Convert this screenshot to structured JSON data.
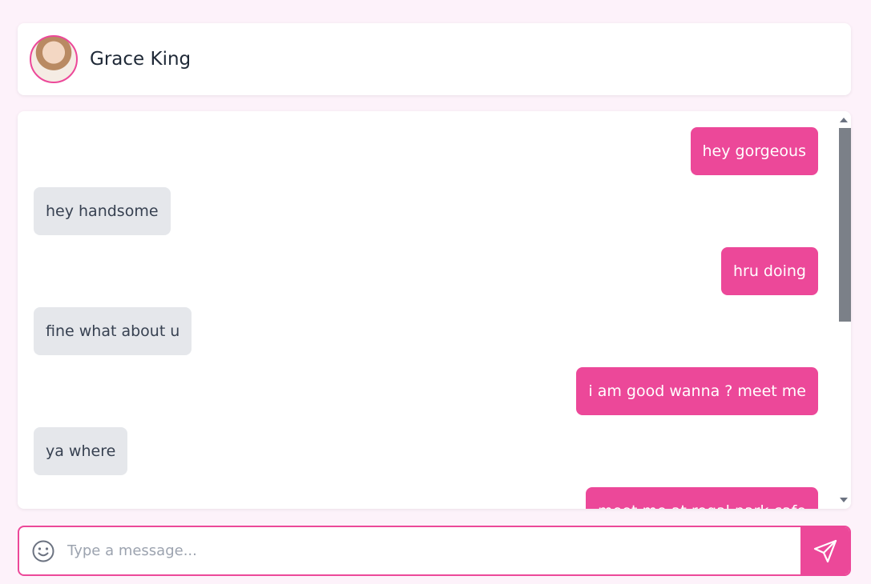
{
  "header": {
    "contact_name": "Grace King",
    "avatar_alt": "avatar"
  },
  "messages": [
    {
      "from": "me",
      "text": "hey gorgeous"
    },
    {
      "from": "them",
      "text": "hey handsome"
    },
    {
      "from": "me",
      "text": "hru doing"
    },
    {
      "from": "them",
      "text": "fine what about u"
    },
    {
      "from": "me",
      "text": "i am good wanna ? meet me"
    },
    {
      "from": "them",
      "text": "ya where"
    },
    {
      "from": "me",
      "text": "meet me at regal park cafe"
    }
  ],
  "composer": {
    "placeholder": "Type a message...",
    "value": ""
  },
  "icons": {
    "emoji": "smiley-icon",
    "send": "send-paper-plane-icon"
  },
  "colors": {
    "accent": "#ec4899",
    "page_bg": "#fdf2fa",
    "received_bubble": "#e5e7eb"
  }
}
